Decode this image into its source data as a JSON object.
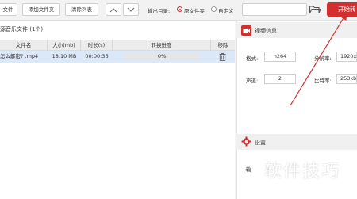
{
  "toolbar": {
    "add_file": "文件",
    "add_folder": "添加文件夹",
    "clear_list": "清除列表",
    "output_dir_label": "输出目录:",
    "option_source_folder": "原文件夹",
    "option_custom": "自定义",
    "output_path_value": "",
    "start_button": "开始转"
  },
  "file_list": {
    "section_title": "源音乐文件 (1个)",
    "columns": [
      "文件名",
      "大小(mb)",
      "时长(s)",
      "转换进度",
      "移除"
    ],
    "rows": [
      {
        "name": "怎么解密? .mp4",
        "size": "18.10 MB",
        "duration": "00:00:36",
        "progress": "0%",
        "progress_fraction": 0
      }
    ]
  },
  "video_info": {
    "title": "视频信息",
    "format_label": "格式:",
    "format_value": "h264",
    "resolution_label": "分辨率:",
    "resolution_value": "1920x",
    "channel_label": "声道:",
    "channel_value": "2",
    "bitrate_label": "比特率:",
    "bitrate_value": "253kb"
  },
  "settings": {
    "title": "设置",
    "item_label": "输"
  },
  "watermark": "软件技巧",
  "colors": {
    "accent": "#d32f2f",
    "row_selected": "#dbe8f7"
  }
}
